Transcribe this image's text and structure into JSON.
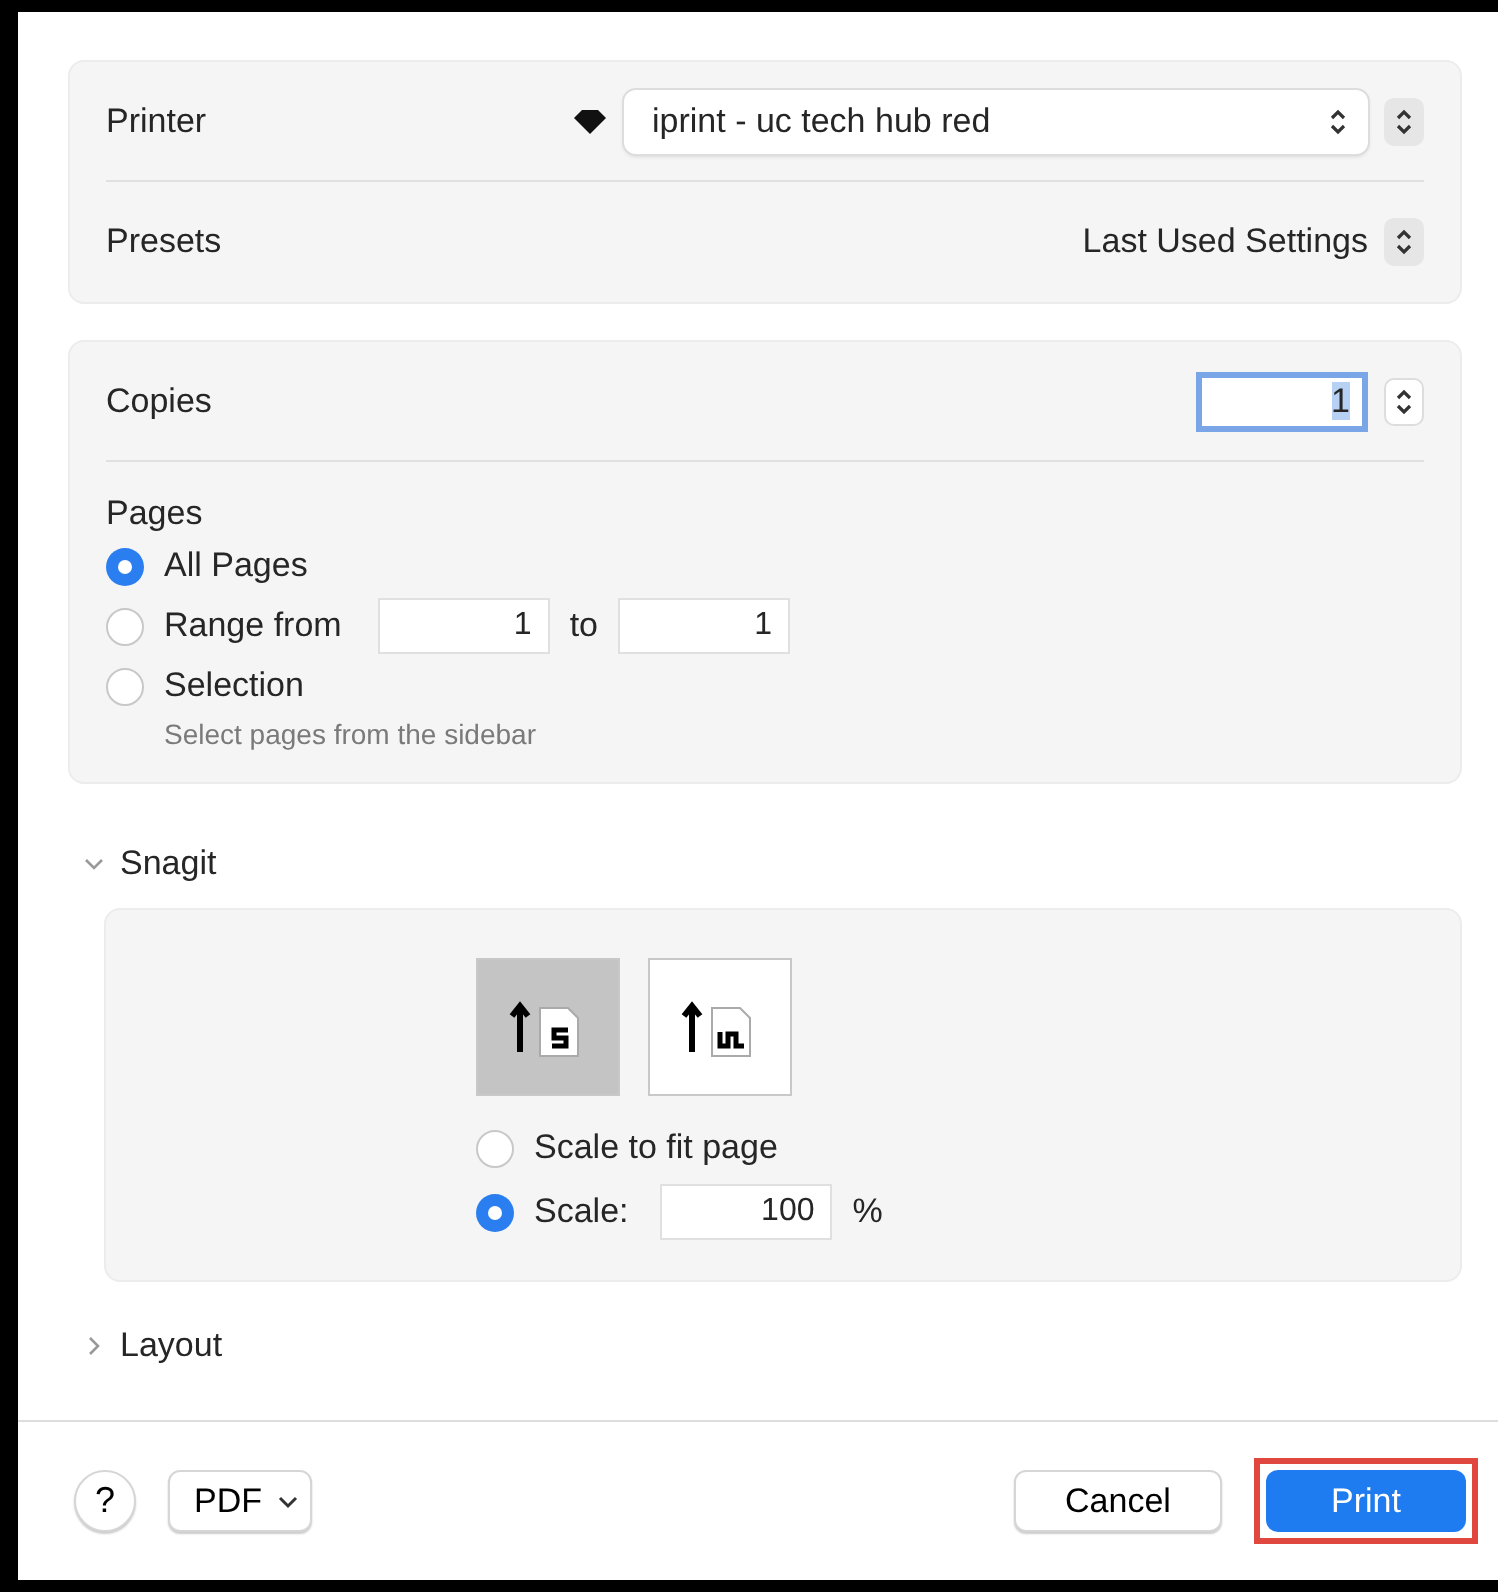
{
  "printer": {
    "label": "Printer",
    "value": "iprint - uc tech hub red"
  },
  "presets": {
    "label": "Presets",
    "value": "Last Used Settings"
  },
  "copies": {
    "label": "Copies",
    "value": "1"
  },
  "pages": {
    "label": "Pages",
    "options": [
      {
        "kind": "plain",
        "label": "All Pages",
        "selected": true
      },
      {
        "kind": "range",
        "label": "Range from",
        "from": "1",
        "to_label": "to",
        "to": "1",
        "selected": false
      },
      {
        "kind": "hint",
        "label": "Selection",
        "hint": "Select pages from the sidebar",
        "selected": false
      }
    ]
  },
  "snagit": {
    "title": "Snagit",
    "expanded": true,
    "orientations": [
      {
        "kind": "portrait",
        "selected": true
      },
      {
        "kind": "landscape",
        "selected": false
      }
    ],
    "scale_options": [
      {
        "kind": "plain",
        "label": "Scale to fit page",
        "selected": false
      },
      {
        "kind": "value",
        "label": "Scale:",
        "value": "100",
        "unit": "%",
        "selected": true
      }
    ]
  },
  "layout_section": {
    "title": "Layout",
    "expanded": false
  },
  "footer": {
    "help": "?",
    "pdf": "PDF",
    "cancel": "Cancel",
    "print": {
      "label": "Print",
      "highlighted": true
    }
  }
}
